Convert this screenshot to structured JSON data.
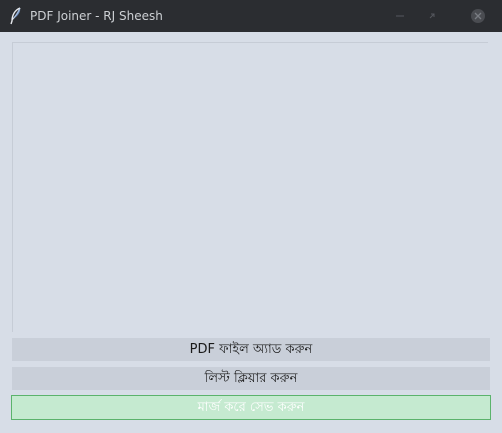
{
  "window": {
    "title": "PDF Joiner - RJ Sheesh",
    "icon": "feather-icon",
    "controls": [
      "minimize-icon",
      "maximize-icon",
      "close-icon"
    ]
  },
  "file_list": {
    "items": []
  },
  "buttons": {
    "add_label": "PDF ফাইল অ্যাড করুন",
    "clear_label": "লিস্ট ক্লিয়ার করুন",
    "merge_label": "মার্জ করে সেভ করুন"
  },
  "colors": {
    "titlebar": "#2b2d31",
    "window_bg": "#d7dde7",
    "button_bg": "#c9cfd9",
    "merge_bg": "#c5ead0",
    "merge_border": "#5bb36c"
  }
}
